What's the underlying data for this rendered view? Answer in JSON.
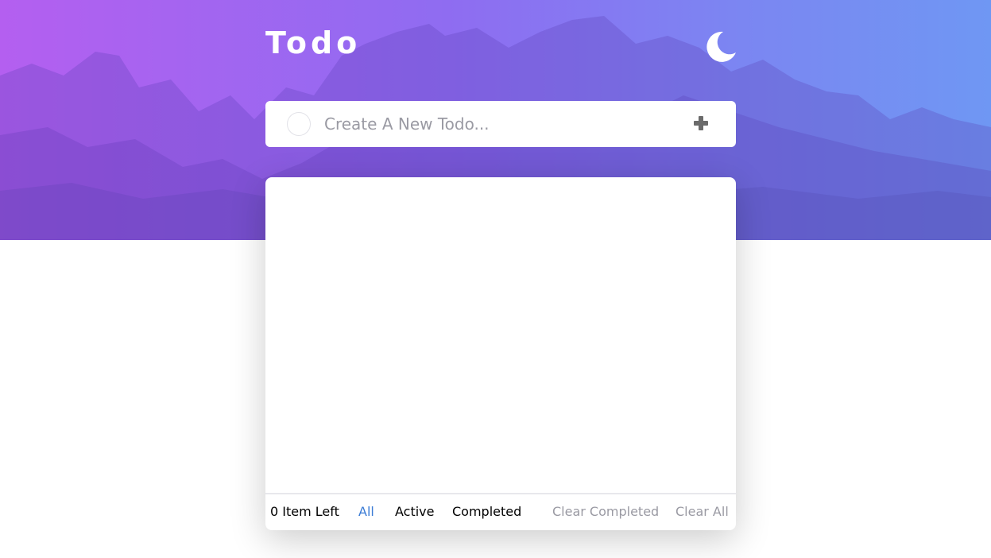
{
  "header": {
    "title": "Todo",
    "theme_icon": "moon-icon"
  },
  "new_todo": {
    "placeholder": "Create A New Todo...",
    "value": "",
    "add_icon": "plus-icon"
  },
  "todos": [],
  "footer": {
    "items_left": "0 Item Left",
    "filters": [
      "All",
      "Active",
      "Completed"
    ],
    "active_filter": "All",
    "clear_completed": "Clear Completed",
    "clear_all": "Clear All"
  },
  "colors": {
    "gradient_start": "#b45ff0",
    "gradient_end": "#6f97f3",
    "active_filter": "#3a7bd5",
    "muted_text": "#9a9aa3"
  }
}
